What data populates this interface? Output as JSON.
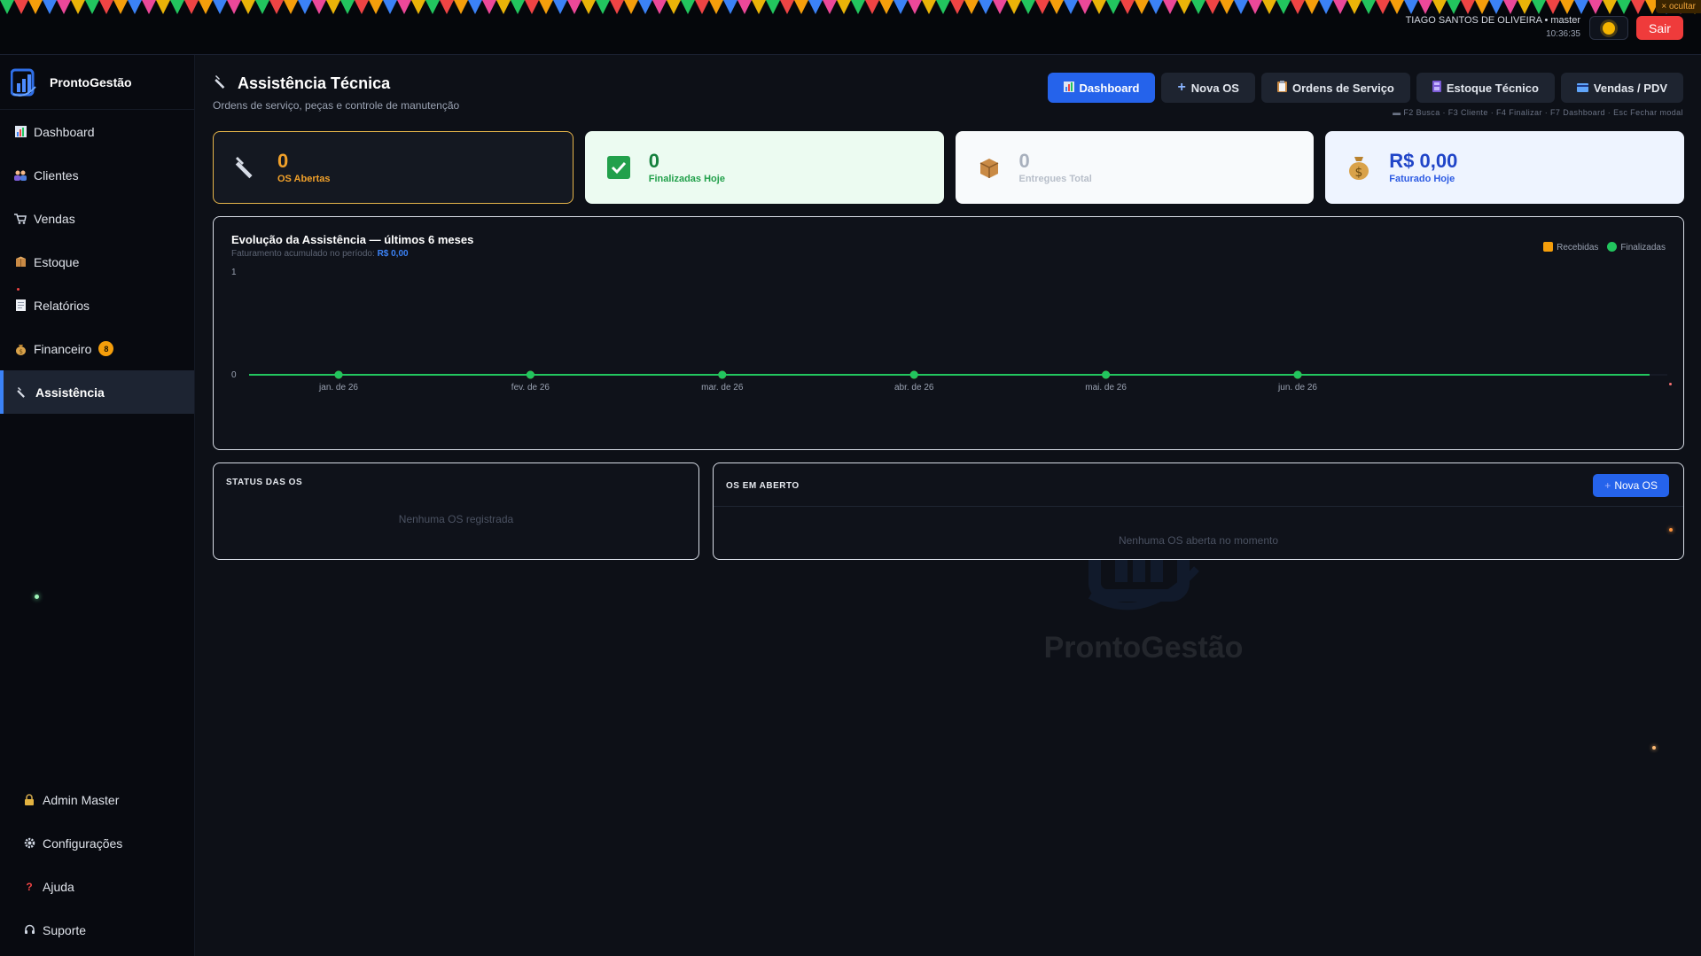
{
  "topbar": {
    "user": "TIAGO SANTOS DE OLIVEIRA • master",
    "time": "10:36:35",
    "logout_label": "Sair",
    "hide_label": "× ocultar",
    "theme_icon": "sun-icon"
  },
  "sidebar": {
    "brand": "ProntoGestão",
    "items": [
      {
        "label": "Dashboard",
        "icon": "chart-icon"
      },
      {
        "label": "Clientes",
        "icon": "users-icon"
      },
      {
        "label": "Vendas",
        "icon": "cart-icon"
      },
      {
        "label": "Estoque",
        "icon": "box-icon"
      },
      {
        "label": "Relatórios",
        "icon": "document-icon"
      },
      {
        "label": "Financeiro",
        "icon": "money-bag-icon",
        "badge": "8"
      },
      {
        "label": "Assistência",
        "icon": "wrench-icon",
        "active": true
      }
    ],
    "bottom_items": [
      {
        "label": "Admin Master",
        "icon": "lock-icon"
      },
      {
        "label": "Configurações",
        "icon": "gear-icon"
      },
      {
        "label": "Ajuda",
        "icon": "question-icon"
      },
      {
        "label": "Suporte",
        "icon": "headset-icon"
      }
    ]
  },
  "page": {
    "title": "Assistência Técnica",
    "subtitle": "Ordens de serviço, peças e controle de manutenção",
    "tabs": [
      {
        "label": "Dashboard",
        "icon": "chart-icon",
        "active": true
      },
      {
        "label": "Nova OS",
        "icon": "plus-icon"
      },
      {
        "label": "Ordens de Serviço",
        "icon": "clipboard-icon"
      },
      {
        "label": "Estoque Técnico",
        "icon": "tool-box-icon"
      },
      {
        "label": "Vendas / PDV",
        "icon": "card-icon"
      }
    ],
    "shortcuts": "F2 Busca · F3 Cliente · F4 Finalizar · F7 Dashboard · Esc Fechar modal"
  },
  "stats": [
    {
      "value": "0",
      "label": "OS Abertas",
      "icon": "wrench-icon"
    },
    {
      "value": "0",
      "label": "Finalizadas Hoje",
      "icon": "check-icon"
    },
    {
      "value": "0",
      "label": "Entregues Total",
      "icon": "package-icon"
    },
    {
      "value": "R$ 0,00",
      "label": "Faturado Hoje",
      "icon": "money-bag-icon"
    }
  ],
  "chart_data": {
    "type": "line",
    "title": "Evolução da Assistência — últimos 6 meses",
    "subtitle_prefix": "Faturamento acumulado no período:",
    "subtitle_value": "R$ 0,00",
    "categories": [
      "jan. de 26",
      "fev. de 26",
      "mar. de 26",
      "abr. de 26",
      "mai. de 26",
      "jun. de 26"
    ],
    "series": [
      {
        "name": "Recebidas",
        "values": [
          0,
          0,
          0,
          0,
          0,
          0
        ],
        "color": "#f59e0b"
      },
      {
        "name": "Finalizadas",
        "values": [
          0,
          0,
          0,
          0,
          0,
          0
        ],
        "color": "#22c55e"
      }
    ],
    "yticks": [
      "1",
      "0"
    ],
    "ylim": [
      0,
      1
    ],
    "legend": "top-right"
  },
  "status_card": {
    "title": "STATUS DAS OS",
    "empty": "Nenhuma OS registrada"
  },
  "open_card": {
    "title": "OS EM ABERTO",
    "button": "Nova OS",
    "empty": "Nenhuma OS aberta no momento"
  },
  "watermark": "ProntoGestão",
  "colors": {
    "accent": "#2563eb",
    "danger": "#ef3b3b",
    "warning": "#f0a02a",
    "success": "#22c55e"
  }
}
